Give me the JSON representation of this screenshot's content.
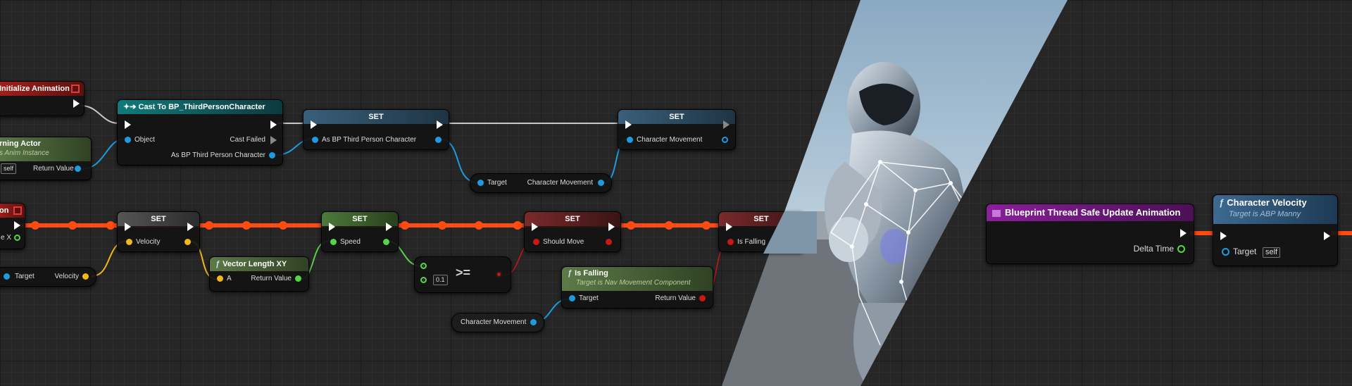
{
  "nodes": {
    "init_anim": {
      "title": "Initialize Animation"
    },
    "owning_actor": {
      "title": "rning Actor",
      "subtitle": "s Anim Instance",
      "self_label": "self",
      "return_label": "Return Value"
    },
    "cast": {
      "title": "Cast To BP_ThirdPersonCharacter",
      "object_label": "Object",
      "cast_failed_label": "Cast Failed",
      "as_label": "As BP Third Person Character"
    },
    "set_char": {
      "title": "SET",
      "pin_label": "As BP Third Person Character"
    },
    "set_move": {
      "title": "SET",
      "pin_label": "Character Movement"
    },
    "get_move": {
      "target_label": "Target",
      "value_label": "Character Movement"
    },
    "update_anim": {
      "title": "on"
    },
    "update_anim_pin": {
      "label": "e X"
    },
    "get_velocity": {
      "target_label": "Target",
      "value_label": "Velocity"
    },
    "set_velocity": {
      "title": "SET",
      "pin_label": "Velocity"
    },
    "vector_length": {
      "title": "Vector Length XY",
      "a_label": "A",
      "return_label": "Return Value"
    },
    "set_speed": {
      "title": "SET",
      "pin_label": "Speed"
    },
    "compare": {
      "value": "0.1",
      "op": ">="
    },
    "set_should_move": {
      "title": "SET",
      "pin_label": "Should Move"
    },
    "is_falling_func": {
      "title": "Is Falling",
      "subtitle": "Target is Nav Movement Component",
      "target_label": "Target",
      "return_label": "Return Value"
    },
    "char_movement_var": {
      "label": "Character Movement"
    },
    "set_is_falling": {
      "title": "SET",
      "pin_label": "Is Falling"
    },
    "thread_safe": {
      "title": "Blueprint Thread Safe Update Animation",
      "delta_label": "Delta Time"
    },
    "char_velocity": {
      "title": "Character Velocity",
      "subtitle": "Target is ABP Manny",
      "target_label": "Target",
      "self_label": "self"
    }
  },
  "colors": {
    "exec_wire": "#ffffff",
    "exec_highlight": "#ff4a12",
    "object_pin": "#1e9be0",
    "vector_pin": "#f0b820",
    "float_pin": "#58d448",
    "bool_pin": "#c81818"
  }
}
